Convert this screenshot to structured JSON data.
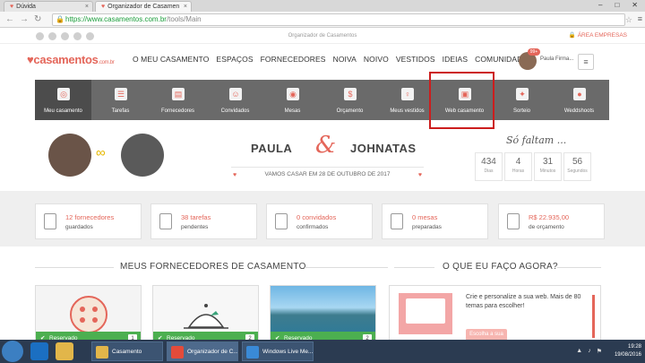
{
  "browser": {
    "tabs": [
      {
        "label": "Dúvida",
        "active": false
      },
      {
        "label": "Organizador de Casamen",
        "active": true
      }
    ],
    "url_host": "https://www.casamentos.com.br",
    "url_path": "/tools/Main"
  },
  "topbar": {
    "center": "Organizador de Casamentos",
    "right": "ÁREA EMPRESAS"
  },
  "nav": {
    "logo": "casamentos",
    "logo_suffix": ".com.br",
    "links": [
      "O MEU CASAMENTO",
      "ESPAÇOS",
      "FORNECEDORES",
      "NOIVA",
      "NOIVO",
      "VESTIDOS",
      "IDEIAS",
      "COMUNIDADE"
    ],
    "badge": "99+",
    "username": "Paula Firma..."
  },
  "tools": [
    {
      "label": "Meu casamento",
      "icon": "rings-icon"
    },
    {
      "label": "Tarefas",
      "icon": "tasks-icon"
    },
    {
      "label": "Fornecedores",
      "icon": "vendors-icon"
    },
    {
      "label": "Convidados",
      "icon": "guests-icon"
    },
    {
      "label": "Mesas",
      "icon": "tables-icon"
    },
    {
      "label": "Orçamento",
      "icon": "budget-icon"
    },
    {
      "label": "Meus vestidos",
      "icon": "dress-icon"
    },
    {
      "label": "Web casamento",
      "icon": "website-icon"
    },
    {
      "label": "Sorteio",
      "icon": "raffle-icon"
    },
    {
      "label": "Weddshoots",
      "icon": "camera-icon"
    }
  ],
  "couple": {
    "name1": "PAULA",
    "amp": "&",
    "name2": "JOHNATAS",
    "wedding_line": "VAMOS CASAR EM 28 DE OUTUBRO DE 2017"
  },
  "countdown": {
    "title": "Só faltam ...",
    "items": [
      {
        "n": "434",
        "u": "Dias"
      },
      {
        "n": "4",
        "u": "Horas"
      },
      {
        "n": "31",
        "u": "Minutos"
      },
      {
        "n": "56",
        "u": "Segundos"
      }
    ]
  },
  "stats": [
    {
      "n": "12 fornecedores",
      "l": "guardados"
    },
    {
      "n": "38 tarefas",
      "l": "pendentes"
    },
    {
      "n": "0 convidados",
      "l": "confirmados"
    },
    {
      "n": "0 mesas",
      "l": "preparadas"
    },
    {
      "n": "R$ 22.935,00",
      "l": "de orçamento"
    }
  ],
  "sections": {
    "left_title": "MEUS FORNECEDORES DE CASAMENTO",
    "right_title": "O QUE EU FAÇO AGORA?"
  },
  "vendor_cards": [
    {
      "status": "Reservado",
      "count": "1"
    },
    {
      "status": "Reservado",
      "count": "2"
    },
    {
      "status": "Reservado",
      "count": "2"
    }
  ],
  "help": {
    "text": "Crie e personalize a sua web. Mais de 80 temas para escolher!",
    "button": "Escolha a sua web"
  },
  "taskbar": {
    "tasks": [
      "Casamento",
      "Organizador de C...",
      "Windows Live Me..."
    ],
    "time": "19:28",
    "date": "19/08/2016"
  },
  "colors": {
    "accent": "#e4665a",
    "toolbar": "#6a6a6a",
    "highlight": "#cc1d1d",
    "reserved": "#4caf50"
  }
}
